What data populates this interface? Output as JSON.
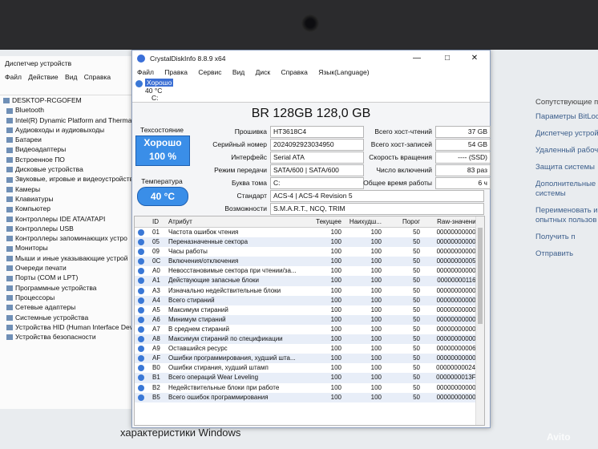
{
  "devmgr": {
    "title": "Диспетчер устройств",
    "menu": [
      "Файл",
      "Действие",
      "Вид",
      "Справка"
    ],
    "items": [
      "DESKTOP-RCGOFEM",
      "Bluetooth",
      "Intel(R) Dynamic Platform and Therma",
      "Аудиовходы и аудиовыходы",
      "Батареи",
      "Видеоадаптеры",
      "Встроенное ПО",
      "Дисковые устройства",
      "Звуковые, игровые и видеоустройств",
      "Камеры",
      "Клавиатуры",
      "Компьютер",
      "Контроллеры IDE ATA/ATAPI",
      "Контроллеры USB",
      "Контроллеры запоминающих устро",
      "Мониторы",
      "Мыши и иные указывающие устрой",
      "Очереди печати",
      "Порты (COM и LPT)",
      "Программные устройства",
      "Процессоры",
      "Сетевые адаптеры",
      "Системные устройства",
      "Устройства HID (Human Interface Dev",
      "Устройства безопасности"
    ]
  },
  "right_panel": {
    "header": "Сопутствующие па",
    "links": [
      "Параметры BitLock",
      "Диспетчер устрой",
      "Удаленный рабоч",
      "Защита системы",
      "Дополнительные системы",
      "Переименовать и опытных пользов",
      "Получить п",
      "Отправить"
    ]
  },
  "app": {
    "title": "CrystalDiskInfo 8.8.9 x64",
    "menu": [
      "Файл",
      "Правка",
      "Сервис",
      "Вид",
      "Диск",
      "Справка",
      "Язык(Language)"
    ],
    "disk_status": "Хорошо",
    "disk_temp": "40 °C",
    "disk_letter": "C:",
    "model": "BR 128GB 128,0 GB",
    "status_label": "Техсостояние",
    "status_value": "Хорошо",
    "status_pct": "100 %",
    "temp_label": "Температура",
    "temp_value": "40 °C"
  },
  "info": {
    "firmware_label": "Прошивка",
    "firmware": "HT3618C4",
    "serial_label": "Серийный номер",
    "serial": "2024092923034950",
    "interface_label": "Интерфейс",
    "interface": "Serial ATA",
    "mode_label": "Режим передачи",
    "mode": "SATA/600 | SATA/600",
    "volume_label": "Буква тома",
    "volume": "C:",
    "standard_label": "Стандарт",
    "standard": "ACS-4 | ACS-4 Revision 5",
    "features_label": "Возможности",
    "features": "S.M.A.R.T., NCQ, TRIM",
    "host_reads_label": "Всего хост-чтений",
    "host_reads": "37 GB",
    "host_writes_label": "Всего хост-записей",
    "host_writes": "54 GB",
    "rotation_label": "Скорость вращения",
    "rotation": "---- (SSD)",
    "power_count_label": "Число включений",
    "power_count": "83 раз",
    "power_hours_label": "Общее время работы",
    "power_hours": "6 ч"
  },
  "smart": {
    "headers": [
      "ID",
      "Атрибут",
      "Текущее",
      "Наихудш...",
      "Порог",
      "Raw-значения"
    ],
    "rows": [
      [
        "01",
        "Частота ошибок чтения",
        "100",
        "100",
        "50",
        "000000000000"
      ],
      [
        "05",
        "Переназначенные сектора",
        "100",
        "100",
        "50",
        "000000000000"
      ],
      [
        "09",
        "Часы работы",
        "100",
        "100",
        "50",
        "000000000006"
      ],
      [
        "0C",
        "Включения/отключения",
        "100",
        "100",
        "50",
        "000000000053"
      ],
      [
        "A0",
        "Невосстановимые сектора при чтении/за...",
        "100",
        "100",
        "50",
        "000000000000"
      ],
      [
        "A1",
        "Действующие запасные блоки",
        "100",
        "100",
        "50",
        "000000001164"
      ],
      [
        "A3",
        "Изначально недействительные блоки",
        "100",
        "100",
        "50",
        "000000000000"
      ],
      [
        "A4",
        "Всего стираний",
        "100",
        "100",
        "50",
        "000000000000"
      ],
      [
        "A5",
        "Максимум стираний",
        "100",
        "100",
        "50",
        "000000000000"
      ],
      [
        "A6",
        "Минимум стираний",
        "100",
        "100",
        "50",
        "000000000000"
      ],
      [
        "A7",
        "В среднем стираний",
        "100",
        "100",
        "50",
        "000000000000"
      ],
      [
        "A8",
        "Максимум стираний по спецификации",
        "100",
        "100",
        "50",
        "000000000000"
      ],
      [
        "A9",
        "Оставшийся ресурс",
        "100",
        "100",
        "50",
        "000000000064"
      ],
      [
        "AF",
        "Ошибки программирования, худший шта...",
        "100",
        "100",
        "50",
        "000000000000"
      ],
      [
        "B0",
        "Ошибки стирания, худший штамп",
        "100",
        "100",
        "50",
        "00000000024F"
      ],
      [
        "B1",
        "Всего операций Wear Leveling",
        "100",
        "100",
        "50",
        "0000000013F5"
      ],
      [
        "B2",
        "Недействительные блоки при работе",
        "100",
        "100",
        "50",
        "000000000000"
      ],
      [
        "B5",
        "Всего ошибок программирования",
        "100",
        "100",
        "50",
        "000000000000"
      ]
    ]
  },
  "bottom_text": "характеристики Windows",
  "watermark": "Avito"
}
